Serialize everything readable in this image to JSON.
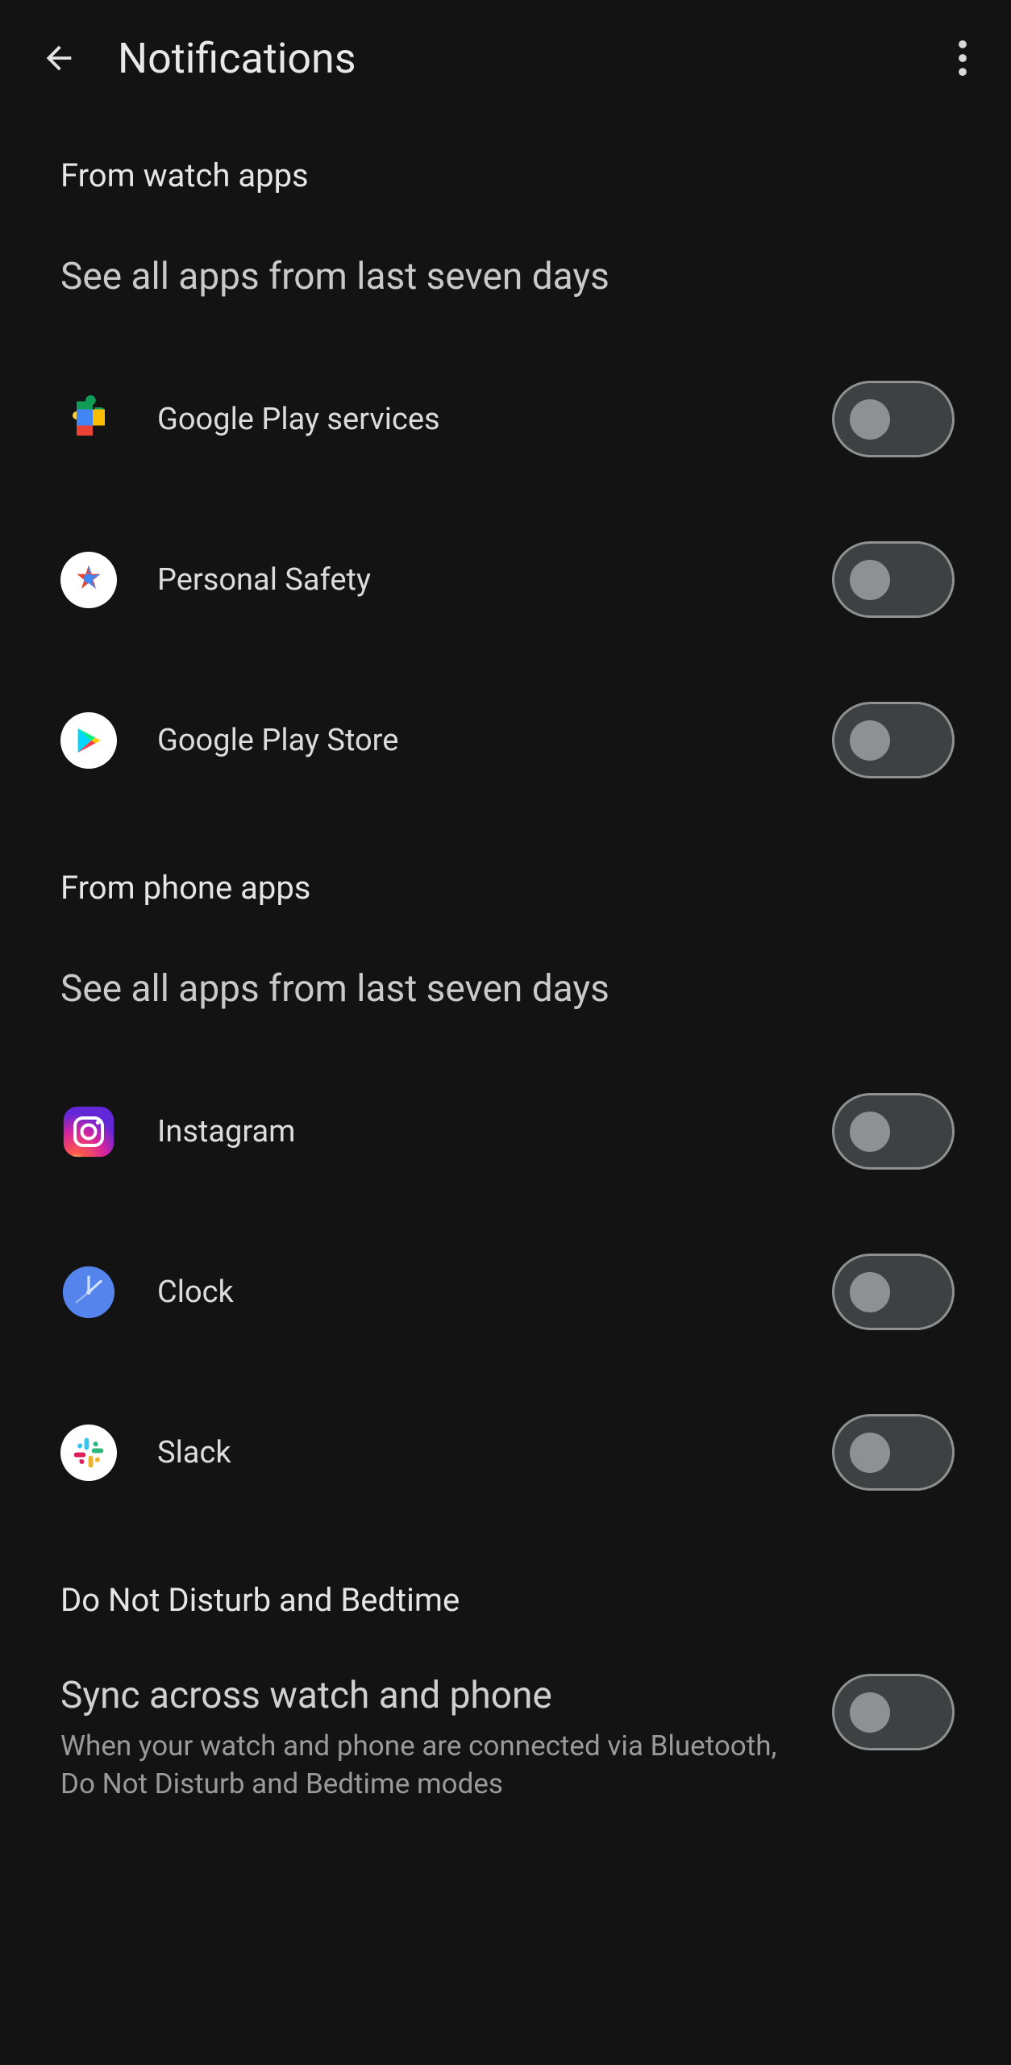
{
  "header": {
    "title": "Notifications"
  },
  "sections": {
    "watch": {
      "label": "From watch apps",
      "see_all": "See all apps from last seven days",
      "apps": [
        {
          "name": "Google Play services"
        },
        {
          "name": "Personal Safety"
        },
        {
          "name": "Google Play Store"
        }
      ]
    },
    "phone": {
      "label": "From phone apps",
      "see_all": "See all apps from last seven days",
      "apps": [
        {
          "name": "Instagram"
        },
        {
          "name": "Clock"
        },
        {
          "name": "Slack"
        }
      ]
    },
    "dnd": {
      "label": "Do Not Disturb and Bedtime"
    },
    "sync": {
      "title": "Sync across watch and phone",
      "desc": "When your watch and phone are connected via Bluetooth, Do Not Disturb and Bedtime modes"
    }
  }
}
